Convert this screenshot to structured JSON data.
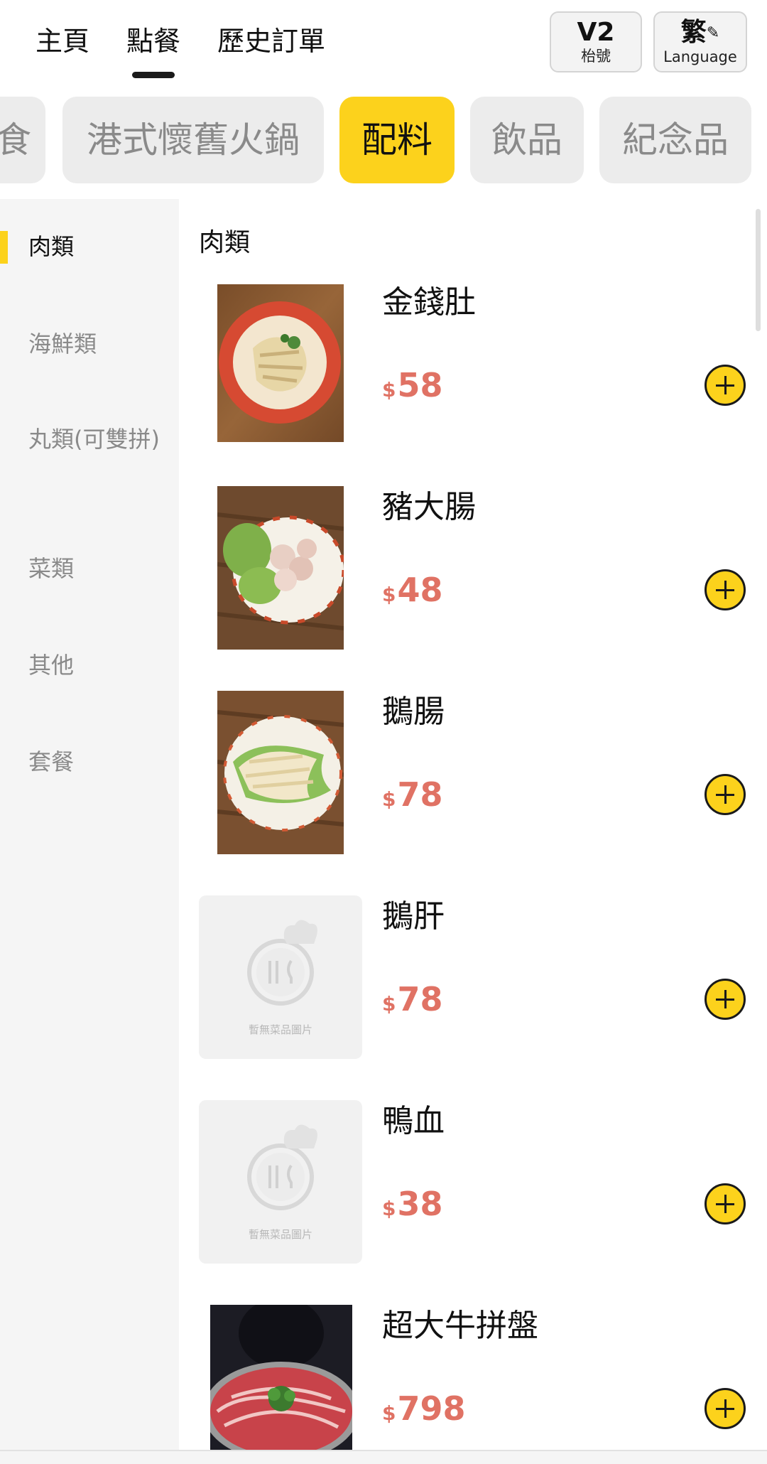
{
  "nav": {
    "tabs": [
      {
        "label": "主頁"
      },
      {
        "label": "點餐"
      },
      {
        "label": "歷史訂單"
      }
    ],
    "active_tab": "點餐",
    "table_button": {
      "value": "V2",
      "caption": "枱號"
    },
    "language_button": {
      "value": "繁",
      "caption": "Language",
      "icon": "pencil-icon"
    }
  },
  "categories": {
    "items": [
      {
        "label": "食"
      },
      {
        "label": "港式懷舊火鍋"
      },
      {
        "label": "配料"
      },
      {
        "label": "飲品"
      },
      {
        "label": "紀念品"
      }
    ],
    "active": "配料",
    "accent_color": "#fcd21c"
  },
  "sidebar": {
    "items": [
      {
        "label": "肉類"
      },
      {
        "label": "海鮮類"
      },
      {
        "label": "丸類(可雙拼)"
      },
      {
        "label": "菜類"
      },
      {
        "label": "其他"
      },
      {
        "label": "套餐"
      }
    ],
    "active": "肉類"
  },
  "menu": {
    "section_title": "肉類",
    "price_color": "#e07264",
    "items": [
      {
        "name": "金錢肚",
        "currency": "$",
        "price": "58"
      },
      {
        "name": "豬大腸",
        "currency": "$",
        "price": "48"
      },
      {
        "name": "鵝腸",
        "currency": "$",
        "price": "78"
      },
      {
        "name": "鵝肝",
        "currency": "$",
        "price": "78",
        "placeholder_text": "暫無菜品圖片"
      },
      {
        "name": "鴨血",
        "currency": "$",
        "price": "38",
        "placeholder_text": "暫無菜品圖片"
      },
      {
        "name": "超大牛拼盤",
        "currency": "$",
        "price": "798"
      }
    ]
  }
}
